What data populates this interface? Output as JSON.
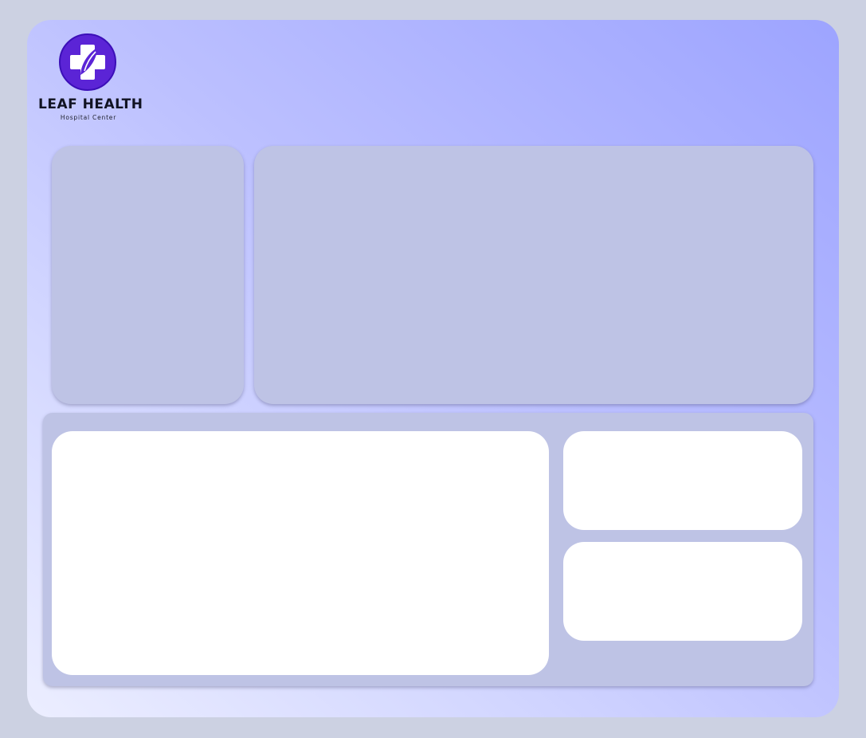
{
  "brand": {
    "name": "LEAF HEALTH",
    "subtitle": "Hospital Center",
    "logo_icon": "medical-cross-leaf-icon",
    "accent_color": "#5b24d6"
  },
  "colors": {
    "page_background": "#ccd1e2",
    "panel_background": "#bec3e5",
    "card_background": "#ffffff",
    "gradient_start": "#eceeff",
    "gradient_end": "#9da4ff"
  }
}
